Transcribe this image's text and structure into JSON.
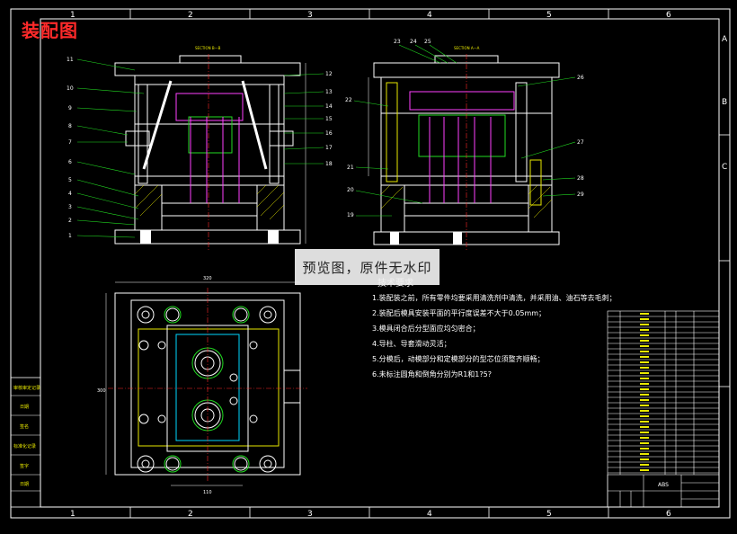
{
  "title": "装配图",
  "watermark": "预览图，原件无水印",
  "grid": {
    "top": [
      "1",
      "2",
      "3",
      "4",
      "5",
      "6"
    ],
    "bottom": [
      "1",
      "2",
      "3",
      "4",
      "5",
      "6"
    ],
    "right": [
      "A",
      "B",
      "C"
    ]
  },
  "sections": {
    "left": "SECTION B—B",
    "right": "SECTION A—A"
  },
  "callouts": {
    "left_views": [
      "11",
      "10",
      "9",
      "8",
      "7",
      "6",
      "5",
      "4",
      "3",
      "2",
      "1"
    ],
    "middle": [
      "12",
      "13",
      "14",
      "15",
      "16",
      "17",
      "18"
    ],
    "top_right": [
      "23",
      "24",
      "25"
    ],
    "right_view_left": [
      "22",
      "21",
      "20",
      "19"
    ],
    "right_view_right": [
      "26",
      "27",
      "28",
      "29"
    ]
  },
  "dimensions": {
    "plan_width": "320",
    "plan_height": "300",
    "plan_bottom": "110"
  },
  "tech_requirements": {
    "heading": "技术要求",
    "items": [
      "1.装配装之前，所有零件均要采用清洗剂中清洗，并采用油、油石等去毛刺；",
      "2.装配后模具安装平面的平行度误差不大于0.05mm；",
      "3.模具闭合后分型面应均匀密合；",
      "4.导柱、导套滑动灵活；",
      "5.分模后，动模部分和定模部分的型芯位须整齐顺畅；",
      "6.未标注圆角和倒角分别为R1和1?5?"
    ]
  },
  "left_stamp_box": [
    "审核审定记录",
    "日期",
    "签名",
    "标准化记录",
    "签字",
    "日期"
  ],
  "title_block": {
    "material": "ABS"
  },
  "colors": {
    "frame": "#ffffff",
    "accent": "#ff2a2a",
    "cyan": "#00d8ff",
    "green": "#22dd22",
    "yellow": "#e8e800",
    "magenta": "#ff40ff"
  }
}
